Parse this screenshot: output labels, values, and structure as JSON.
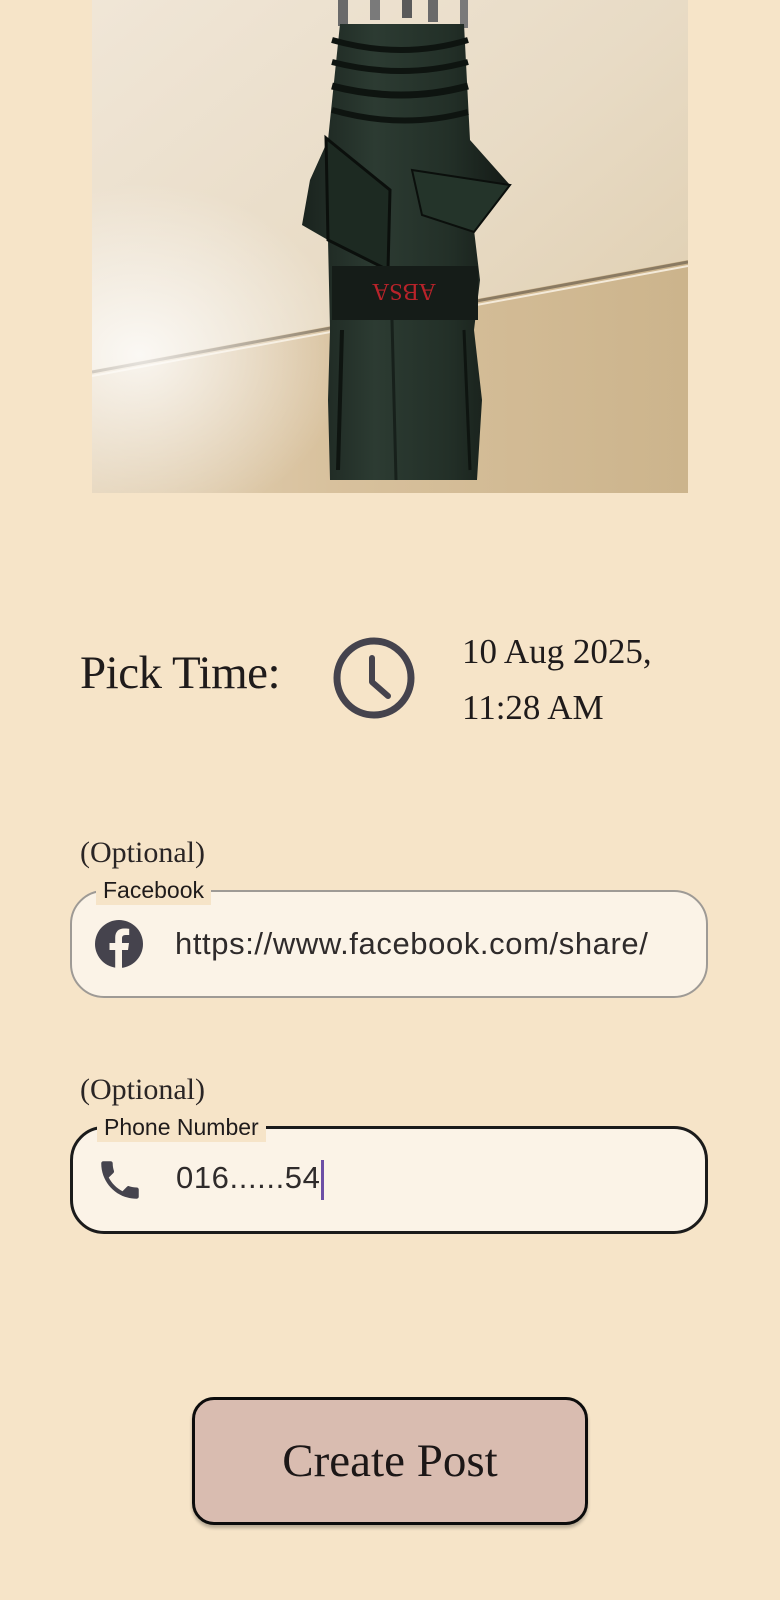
{
  "photo": {
    "alt": "Folded dark green umbrella hanging against a wall",
    "strap_text": "ABSA"
  },
  "pick_time": {
    "label": "Pick Time:",
    "icon": "clock-icon",
    "date_line": "10 Aug 2025,",
    "time_line": "11:28 AM"
  },
  "facebook_field": {
    "optional_label": "(Optional)",
    "label": "Facebook",
    "value": "https://www.facebook.com/share/",
    "icon": "facebook-icon"
  },
  "phone_field": {
    "optional_label": "(Optional)",
    "label": "Phone Number",
    "value": "016......54",
    "icon": "phone-icon",
    "focused": true
  },
  "create_button": {
    "label": "Create Post"
  },
  "colors": {
    "background": "#f6e4c8",
    "field_fill": "#fbf3e7",
    "button_fill": "#d9bcb0",
    "caret": "#6c4fa6",
    "icon": "#45434d"
  }
}
